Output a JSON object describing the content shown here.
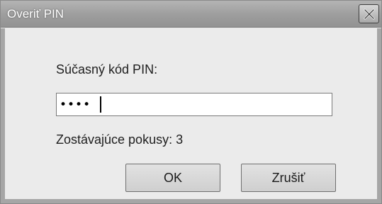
{
  "dialog": {
    "title": "Overiť PIN",
    "close_icon": "close-icon"
  },
  "form": {
    "pin_label": "Súčasný kód PIN:",
    "pin_value": "••••",
    "attempts_text": "Zostávajúce pokusy: 3"
  },
  "buttons": {
    "ok_label": "OK",
    "cancel_label": "Zrušiť"
  }
}
